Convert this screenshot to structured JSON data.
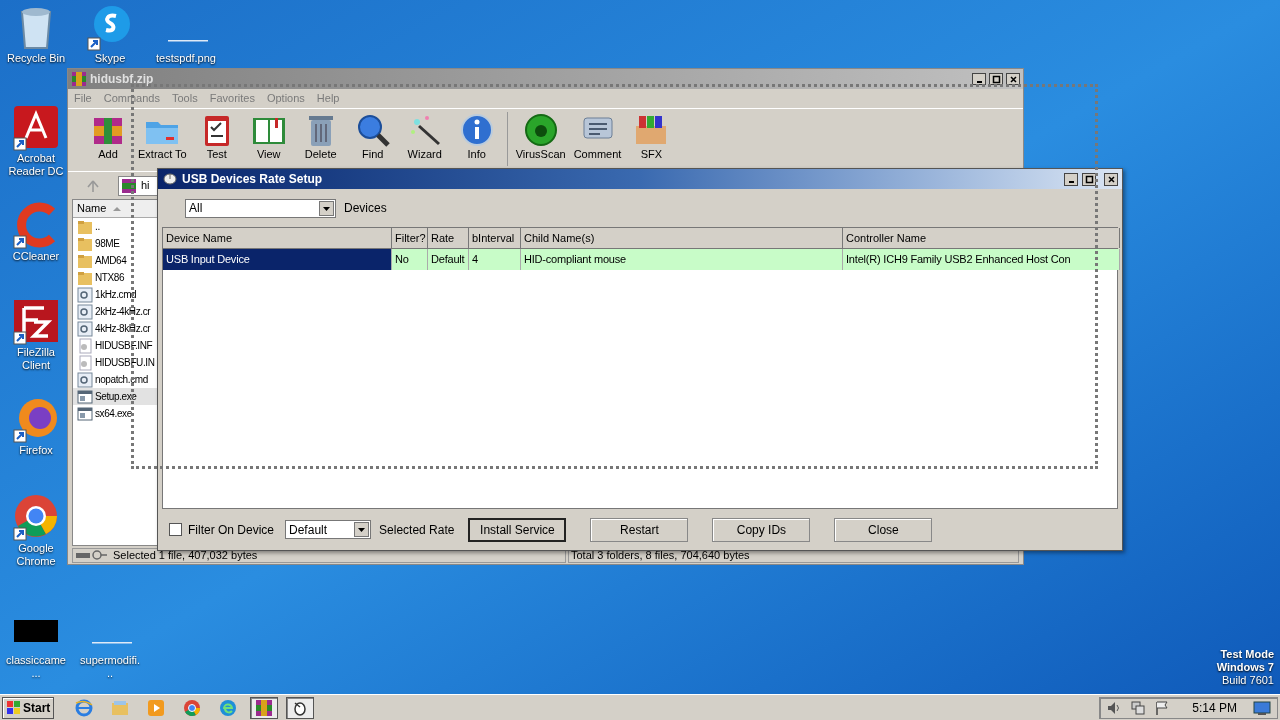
{
  "desktop": {
    "icons": [
      {
        "label": "Recycle Bin",
        "kind": "bin",
        "shortcut": false
      },
      {
        "label": "Skype",
        "kind": "skype",
        "shortcut": true
      },
      {
        "label": "testspdf.png",
        "kind": "blank",
        "shortcut": false
      },
      {
        "label": "Acrobat Reader DC",
        "kind": "acrobat",
        "shortcut": true
      },
      {
        "label": "CCleaner",
        "kind": "ccleaner",
        "shortcut": true
      },
      {
        "label": "FileZilla Client",
        "kind": "filezilla",
        "shortcut": true
      },
      {
        "label": "Firefox",
        "kind": "firefox",
        "shortcut": true
      },
      {
        "label": "Google Chrome",
        "kind": "chrome",
        "shortcut": true
      },
      {
        "label": "classiccame...",
        "kind": "black",
        "shortcut": false
      },
      {
        "label": "supermodifi...",
        "kind": "blank",
        "shortcut": false
      }
    ],
    "system_info": [
      "Test Mode",
      "Windows 7",
      "Build 7601"
    ]
  },
  "archiver": {
    "title": "hidusbf.zip",
    "menu": [
      "File",
      "Commands",
      "Tools",
      "Favorites",
      "Options",
      "Help"
    ],
    "toolbar": [
      {
        "label": "Add",
        "kind": "add"
      },
      {
        "label": "Extract To",
        "kind": "extract"
      },
      {
        "label": "Test",
        "kind": "test"
      },
      {
        "label": "View",
        "kind": "view"
      },
      {
        "label": "Delete",
        "kind": "delete"
      },
      {
        "label": "Find",
        "kind": "find"
      },
      {
        "label": "Wizard",
        "kind": "wizard"
      },
      {
        "label": "Info",
        "kind": "info"
      },
      {
        "label": "VirusScan",
        "kind": "virus"
      },
      {
        "label": "Comment",
        "kind": "comment"
      },
      {
        "label": "SFX",
        "kind": "sfx"
      }
    ],
    "path": "hi",
    "column": "Name",
    "files": [
      {
        "name": "..",
        "kind": "folder",
        "selected": false
      },
      {
        "name": "98ME",
        "kind": "folder",
        "selected": false
      },
      {
        "name": "AMD64",
        "kind": "folder",
        "selected": false
      },
      {
        "name": "NTX86",
        "kind": "folder",
        "selected": false
      },
      {
        "name": "1kHz.cmd",
        "kind": "script",
        "selected": false
      },
      {
        "name": "2kHz-4kHz.cr",
        "kind": "script",
        "selected": false
      },
      {
        "name": "4kHz-8kHz.cr",
        "kind": "script",
        "selected": false
      },
      {
        "name": "HIDUSBF.INF",
        "kind": "config",
        "selected": false
      },
      {
        "name": "HIDUSBFU.IN",
        "kind": "config",
        "selected": false
      },
      {
        "name": "nopatch.cmd",
        "kind": "script",
        "selected": false
      },
      {
        "name": "Setup.exe",
        "kind": "exe",
        "selected": true
      },
      {
        "name": "sx64.exe",
        "kind": "exe",
        "selected": false
      }
    ],
    "status_left": "Selected 1 file, 407,032 bytes",
    "status_right": "Total 3 folders, 8 files, 704,640 bytes"
  },
  "dialog": {
    "title": "USB Devices Rate Setup",
    "device_filter": {
      "value": "All"
    },
    "device_filter_label": "Devices",
    "columns": [
      "Device Name",
      "Filter?",
      "Rate",
      "bInterval",
      "Child Name(s)",
      "Controller Name"
    ],
    "rows": [
      {
        "selected": true,
        "cells": [
          "USB Input Device",
          "No",
          "Default",
          "4",
          "HID-compliant mouse",
          "Intel(R) ICH9 Family USB2 Enhanced Host Con"
        ]
      }
    ],
    "filter_on_device": {
      "label": "Filter On Device",
      "checked": false
    },
    "rate": {
      "value": "Default"
    },
    "rate_label": "Selected Rate",
    "buttons": [
      {
        "label": "Install Service",
        "default": true
      },
      {
        "label": "Restart",
        "default": false
      },
      {
        "label": "Copy IDs",
        "default": false
      },
      {
        "label": "Close",
        "default": false
      }
    ]
  },
  "taskbar": {
    "start": "Start",
    "apps": [
      {
        "kind": "ie",
        "active": false
      },
      {
        "kind": "explorer",
        "active": false
      },
      {
        "kind": "media",
        "active": false
      },
      {
        "kind": "chrome",
        "active": false
      },
      {
        "kind": "edge",
        "active": false
      },
      {
        "kind": "winrar",
        "active": true
      },
      {
        "kind": "usb",
        "active": true
      }
    ],
    "clock": "5:14 PM"
  }
}
